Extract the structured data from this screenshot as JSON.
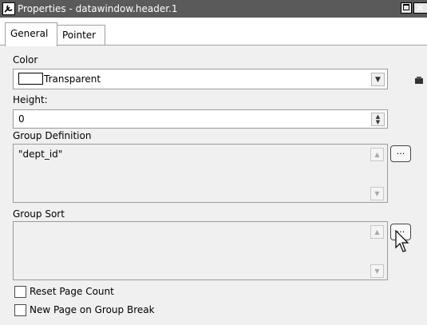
{
  "window": {
    "title": "Properties - datawindow.header.1",
    "icon": "properties-icon"
  },
  "tabs": [
    {
      "label": "General"
    },
    {
      "label": "Pointer"
    }
  ],
  "color": {
    "label": "Color",
    "value": "Transparent"
  },
  "height": {
    "label": "Height:",
    "value": "0"
  },
  "group_definition": {
    "label": "Group Definition",
    "value": "\"dept_id\"",
    "button_label": "..."
  },
  "group_sort": {
    "label": "Group Sort",
    "value": "",
    "button_label": "..."
  },
  "checkboxes": [
    {
      "label": "Reset Page Count",
      "checked": false
    },
    {
      "label": "New Page on Group Break",
      "checked": false
    }
  ]
}
